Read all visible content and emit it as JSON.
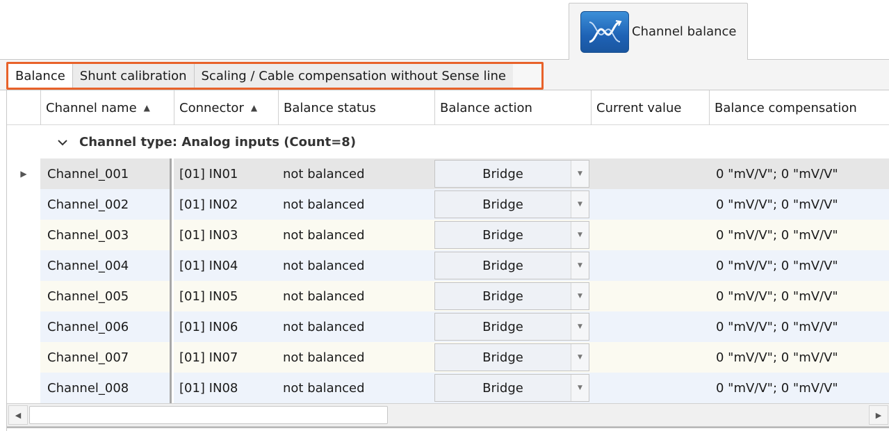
{
  "window": {
    "tab_label": "Channel balance",
    "tab_icon": "channel-balance-icon"
  },
  "subtabs": [
    {
      "label": "Balance",
      "active": true
    },
    {
      "label": "Shunt calibration",
      "active": false
    },
    {
      "label": "Scaling / Cable compensation without Sense line",
      "active": false
    }
  ],
  "columns": {
    "channel_name": "Channel name",
    "connector": "Connector",
    "balance_status": "Balance status",
    "balance_action": "Balance action",
    "current_value": "Current value",
    "balance_compensation": "Balance compensation"
  },
  "group": {
    "label": "Channel type: Analog inputs (Count=8)"
  },
  "rows": [
    {
      "name": "Channel_001",
      "connector": "[01] IN01",
      "status": "not balanced",
      "action": "Bridge",
      "value": "",
      "compensation": "0 \"mV/V\"; 0 \"mV/V\""
    },
    {
      "name": "Channel_002",
      "connector": "[01] IN02",
      "status": "not balanced",
      "action": "Bridge",
      "value": "",
      "compensation": "0 \"mV/V\"; 0 \"mV/V\""
    },
    {
      "name": "Channel_003",
      "connector": "[01] IN03",
      "status": "not balanced",
      "action": "Bridge",
      "value": "",
      "compensation": "0 \"mV/V\"; 0 \"mV/V\""
    },
    {
      "name": "Channel_004",
      "connector": "[01] IN04",
      "status": "not balanced",
      "action": "Bridge",
      "value": "",
      "compensation": "0 \"mV/V\"; 0 \"mV/V\""
    },
    {
      "name": "Channel_005",
      "connector": "[01] IN05",
      "status": "not balanced",
      "action": "Bridge",
      "value": "",
      "compensation": "0 \"mV/V\"; 0 \"mV/V\""
    },
    {
      "name": "Channel_006",
      "connector": "[01] IN06",
      "status": "not balanced",
      "action": "Bridge",
      "value": "",
      "compensation": "0 \"mV/V\"; 0 \"mV/V\""
    },
    {
      "name": "Channel_007",
      "connector": "[01] IN07",
      "status": "not balanced",
      "action": "Bridge",
      "value": "",
      "compensation": "0 \"mV/V\"; 0 \"mV/V\""
    },
    {
      "name": "Channel_008",
      "connector": "[01] IN08",
      "status": "not balanced",
      "action": "Bridge",
      "value": "",
      "compensation": "0 \"mV/V\"; 0 \"mV/V\""
    }
  ],
  "colors": {
    "highlight_border": "#e8622a",
    "row_even": "#eef3fb",
    "row_odd": "#fbfaf1",
    "row_selected": "#e6e6e6"
  }
}
